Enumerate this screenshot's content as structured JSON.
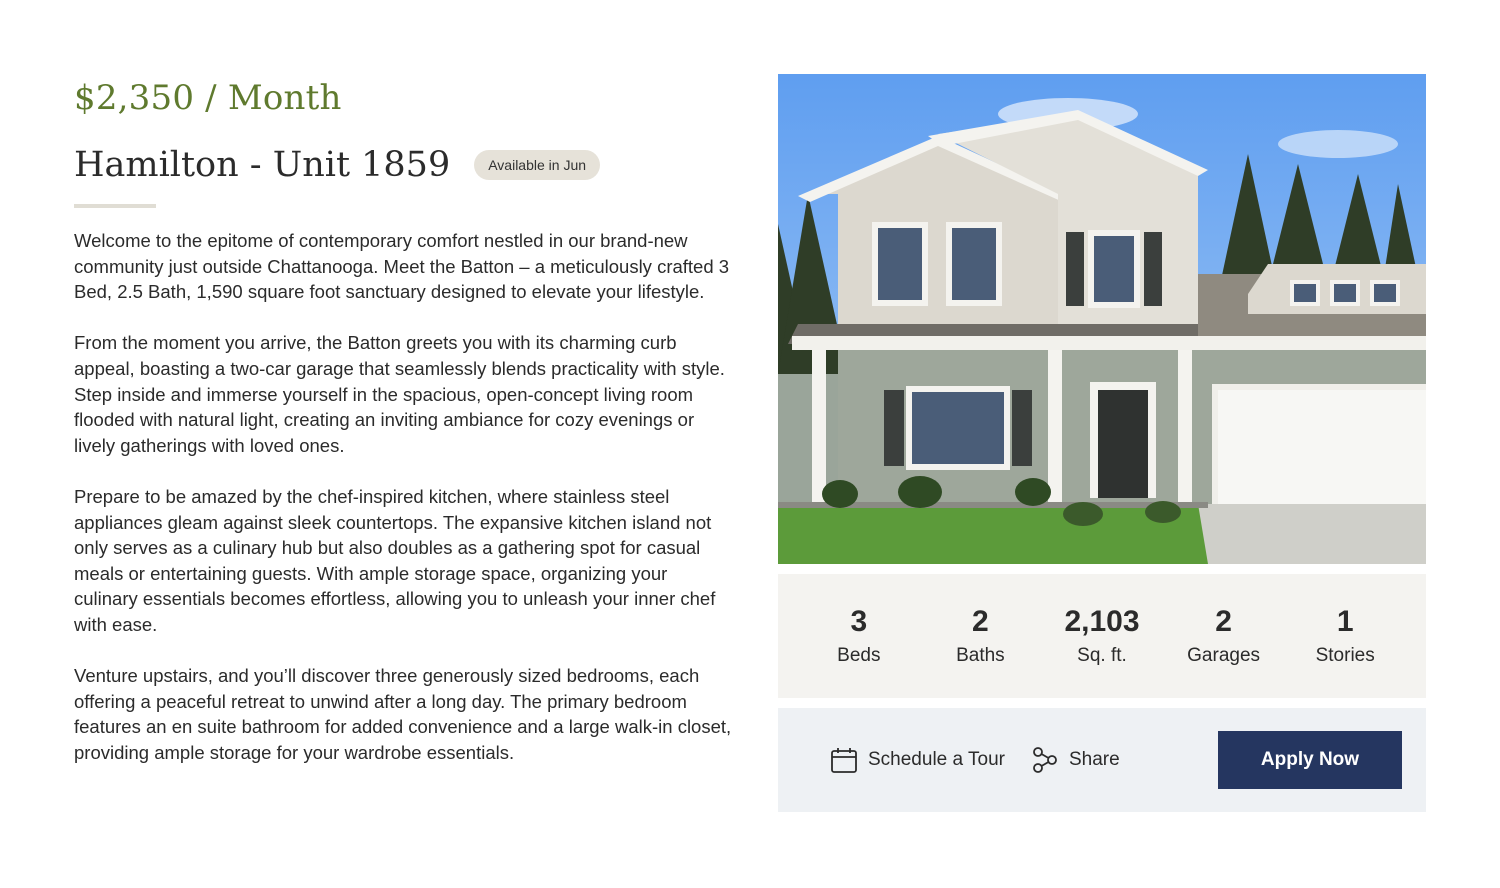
{
  "listing": {
    "price": "$2,350 / Month",
    "title": "Hamilton - Unit 1859",
    "availability": "Available in Jun"
  },
  "description": [
    "Welcome to the epitome of contemporary comfort nestled in our brand-new community just outside Chattanooga. Meet the Batton – a meticulously crafted 3 Bed, 2.5 Bath, 1,590 square foot sanctuary designed to elevate your lifestyle.",
    "From the moment you arrive, the Batton greets you with its charming curb appeal, boasting a two-car garage that seamlessly blends practicality with style. Step inside and immerse yourself in the spacious, open-concept living room flooded with natural light, creating an inviting ambiance for cozy evenings or lively gatherings with loved ones.",
    "Prepare to be amazed by the chef-inspired kitchen, where stainless steel appliances gleam against sleek countertops. The expansive kitchen island not only serves as a culinary hub but also doubles as a gathering spot for casual meals or entertaining guests. With ample storage space, organizing your culinary essentials becomes effortless, allowing you to unleash your inner chef with ease.",
    "Venture upstairs, and you’ll discover three generously sized bedrooms, each offering a peaceful retreat to unwind after a long day. The primary bedroom features an en suite bathroom for added convenience and a large walk-in closet, providing ample storage for your wardrobe essentials."
  ],
  "stats": [
    {
      "value": "3",
      "label": "Beds"
    },
    {
      "value": "2",
      "label": "Baths"
    },
    {
      "value": "2,103",
      "label": "Sq. ft."
    },
    {
      "value": "2",
      "label": "Garages"
    },
    {
      "value": "1",
      "label": "Stories"
    }
  ],
  "actions": {
    "schedule_label": "Schedule a Tour",
    "share_label": "Share",
    "apply_label": "Apply Now"
  },
  "colors": {
    "price_green": "#5f7a2e",
    "apply_navy": "#253660",
    "badge_bg": "#e6e2d9",
    "stats_bg": "#f4f3f0",
    "actions_bg": "#eef1f4"
  },
  "icons": {
    "schedule": "calendar-icon",
    "share": "share-icon"
  }
}
